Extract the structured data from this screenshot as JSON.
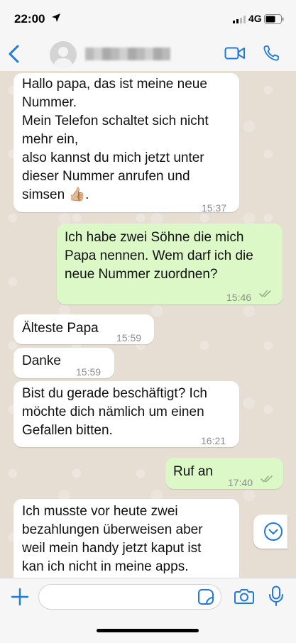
{
  "status_bar": {
    "time": "22:00",
    "network": "4G"
  },
  "header": {
    "back_icon": "chevron-left-icon",
    "video_icon": "video-icon",
    "call_icon": "phone-icon"
  },
  "messages": [
    {
      "direction": "incoming",
      "text": "Hallo papa, das ist meine neue\nNummer.\nMein Telefon schaltet sich nicht\nmehr ein,\nalso kannst du mich jetzt unter\ndieser Nummer anrufen und\nsimsen 👍🏼.",
      "time": "15:37"
    },
    {
      "direction": "outgoing",
      "text": "Ich habe zwei Söhne die mich\nPapa nennen. Wem darf ich die\nneue Nummer zuordnen?",
      "time": "15:46",
      "read": true
    },
    {
      "direction": "incoming",
      "text": "Älteste Papa",
      "time": "15:59"
    },
    {
      "direction": "incoming",
      "text": "Danke",
      "time": "15:59"
    },
    {
      "direction": "incoming",
      "text": "Bist du gerade beschäftigt? Ich\nmöchte dich nämlich um einen\nGefallen bitten.",
      "time": "16:21"
    },
    {
      "direction": "outgoing",
      "text": "Ruf an",
      "time": "17:40",
      "read": true
    },
    {
      "direction": "incoming",
      "text": "Ich musste vor heute zwei\nbezahlungen überweisen aber\nweil mein handy jetzt kaput ist\nkan ich nicht in meine apps.",
      "time": ""
    }
  ],
  "input_bar": {
    "message_placeholder": "",
    "icons": [
      "plus-icon",
      "sticker-icon",
      "camera-icon",
      "microphone-icon"
    ]
  },
  "colors": {
    "accent": "#1f7ae0",
    "outgoing_bubble": "#dcf8c6",
    "incoming_bubble": "#ffffff",
    "read_ticks": "#8fb58a"
  }
}
